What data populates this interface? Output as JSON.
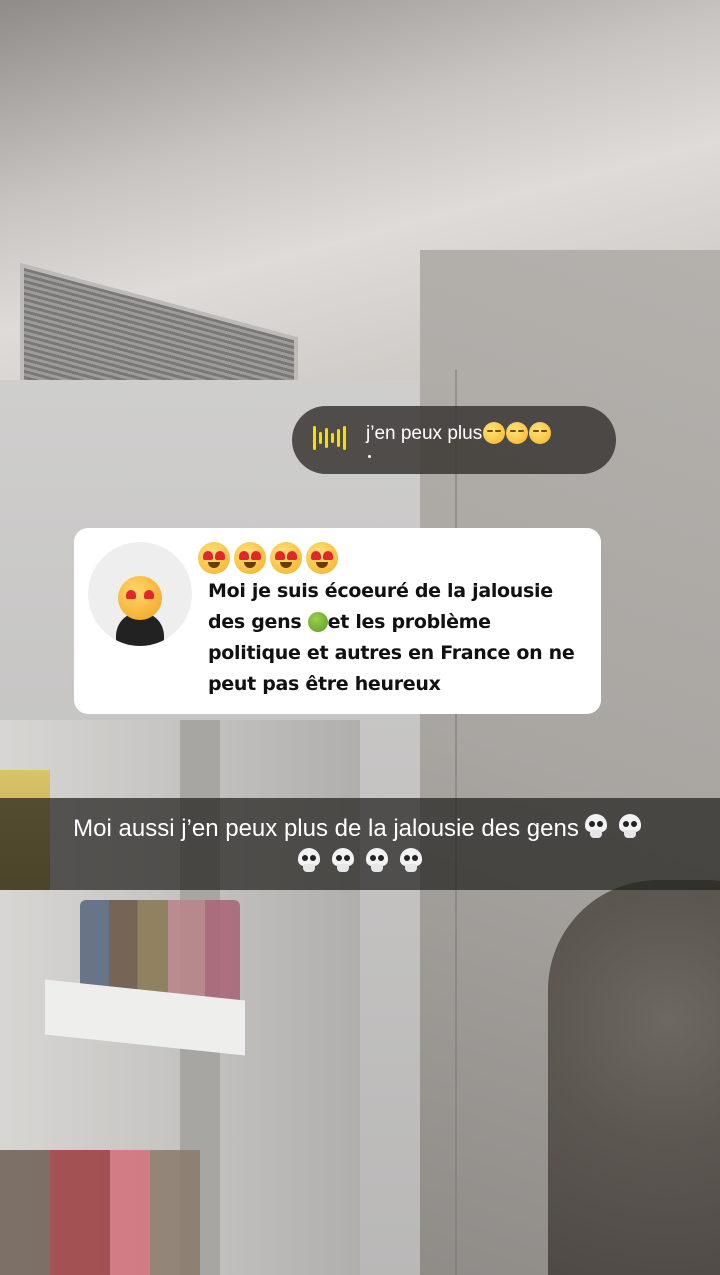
{
  "audio_reply": {
    "text": "j’en peux plus",
    "emoji": [
      "pensive-face",
      "pensive-face",
      "pensive-face"
    ],
    "accent_color": "#f5e000"
  },
  "question_card": {
    "header_emoji": [
      "heart-eyes-face",
      "heart-eyes-face",
      "heart-eyes-face",
      "heart-eyes-face"
    ],
    "text_part1": "Moi je suis écoeuré de la  jalousie des gens ",
    "text_part2": "et les problème politique et autres en France on ne peut pas être heureux",
    "inline_emoji": "nauseated-face"
  },
  "caption": {
    "text": "Moi aussi j’en peux plus de la jalousie des gens",
    "emoji": [
      "skull",
      "skull",
      "skull",
      "skull",
      "skull",
      "skull"
    ]
  }
}
